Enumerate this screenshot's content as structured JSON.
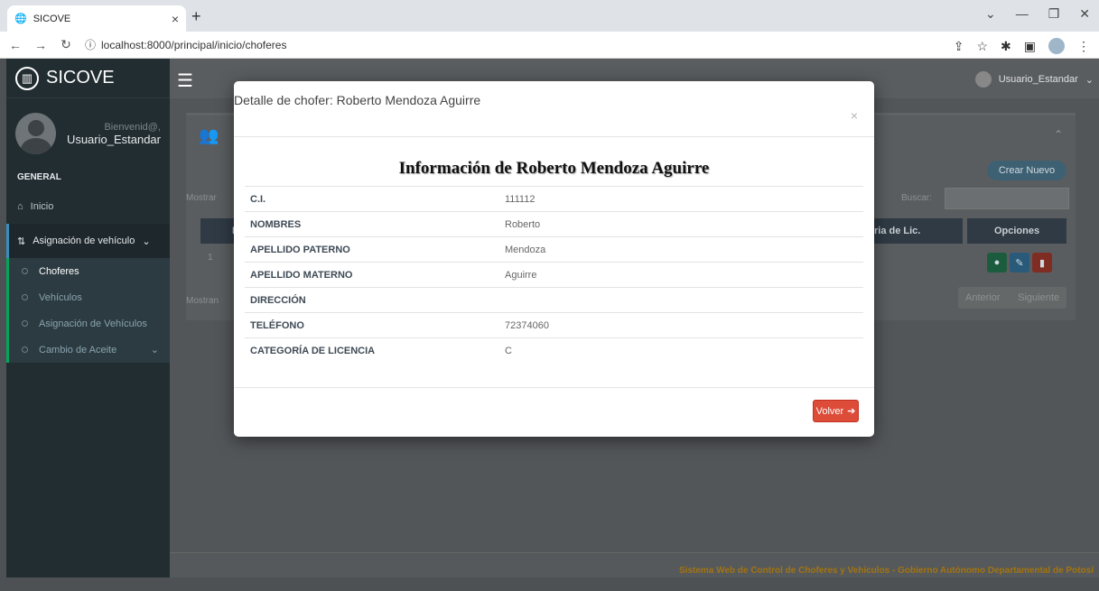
{
  "browser": {
    "tab_title": "SICOVE",
    "url": "localhost:8000/principal/inicio/choferes"
  },
  "app": {
    "brand": "SICOVE",
    "greeting": "Bienvenid@,",
    "username": "Usuario_Estandar",
    "top_user": "Usuario_Estandar",
    "section_label": "GENERAL",
    "menu": {
      "inicio": "Inicio",
      "asignacion": "Asignación de vehículo",
      "sub": [
        "Choferes",
        "Vehículos",
        "Asignación de Vehículos"
      ],
      "cambio": "Cambio de Aceite"
    },
    "footer": "Sistema Web de Control de Choferes y Vehiculos - Gobierno Autónomo Departamental de Potosí"
  },
  "background": {
    "crear_nuevo": "Crear Nuevo",
    "mostrar": "Mostrar",
    "mostrar2": "Mostran",
    "buscar": "Buscar:",
    "col_nro": "Nro",
    "col_lic": "ria de Lic.",
    "col_opciones": "Opciones",
    "row_nro": "1",
    "anterior": "Anterior",
    "siguiente": "Siguiente"
  },
  "modal": {
    "title": "Detalle de chofer: Roberto Mendoza Aguirre",
    "close": "×",
    "heading": "Información de Roberto Mendoza Aguirre",
    "rows": [
      {
        "label": "C.I.",
        "value": "111112"
      },
      {
        "label": "NOMBRES",
        "value": "Roberto"
      },
      {
        "label": "APELLIDO PATERNO",
        "value": "Mendoza"
      },
      {
        "label": "APELLIDO MATERNO",
        "value": "Aguirre"
      },
      {
        "label": "DIRECCIÓN",
        "value": ""
      },
      {
        "label": "TELÉFONO",
        "value": "72374060"
      },
      {
        "label": "CATEGORÍA DE LICENCIA",
        "value": "C"
      }
    ],
    "volver": "Volver"
  },
  "colors": {
    "sidebar": "#222d32",
    "accent_red": "#dd4b39",
    "accent_green": "#00a65a",
    "accent_blue": "#3c8dbc"
  }
}
